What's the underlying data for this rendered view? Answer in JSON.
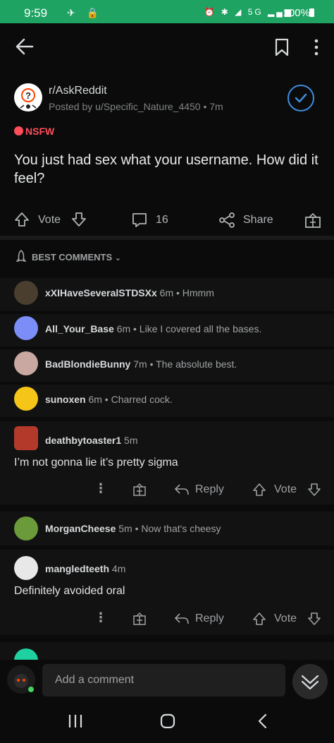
{
  "status": {
    "time": "9:59",
    "battery": "100%",
    "network": "5G"
  },
  "post": {
    "subreddit": "r/AskReddit",
    "byline": "Posted by u/Specific_Nature_4450 • 7m",
    "nsfw": "NSFW",
    "title": "You just had sex what your username. How did it feel?",
    "vote_label": "Vote",
    "comment_count": "16",
    "share_label": "Share"
  },
  "sort": {
    "label": "BEST COMMENTS"
  },
  "comments": [
    {
      "user": "xXIHaveSeveralSTDSXx",
      "meta": "6m • Hmmm",
      "avatar_color": "#4a3f2e"
    },
    {
      "user": "All_Your_Base",
      "meta": "6m • Like I covered all the bases.",
      "avatar_color": "#7b8ef7"
    },
    {
      "user": "BadBlondieBunny",
      "meta": "7m • The absolute best.",
      "avatar_color": "#c9a8a2"
    },
    {
      "user": "sunoxen",
      "meta": "6m • Charred cock.",
      "avatar_color": "#f5c518"
    },
    {
      "user": "deathbytoaster1",
      "meta": "5m",
      "body": "I’m not gonna lie it’s pretty sigma",
      "avatar_color": "#b33a2b",
      "reply_label": "Reply",
      "vote_label": "Vote"
    },
    {
      "user": "MorganCheese",
      "meta": "5m • Now that's cheesy",
      "avatar_color": "#6b9a3a"
    },
    {
      "user": "mangledteeth",
      "meta": "4m",
      "body": "Definitely avoided oral",
      "avatar_color": "#e8e8e8",
      "reply_label": "Reply",
      "vote_label": "Vote"
    }
  ],
  "composer": {
    "placeholder": "Add a comment"
  },
  "colors": {
    "status_bar": "#1fa363",
    "nsfw": "#ff4d5a",
    "join": "#3d8fe0"
  }
}
